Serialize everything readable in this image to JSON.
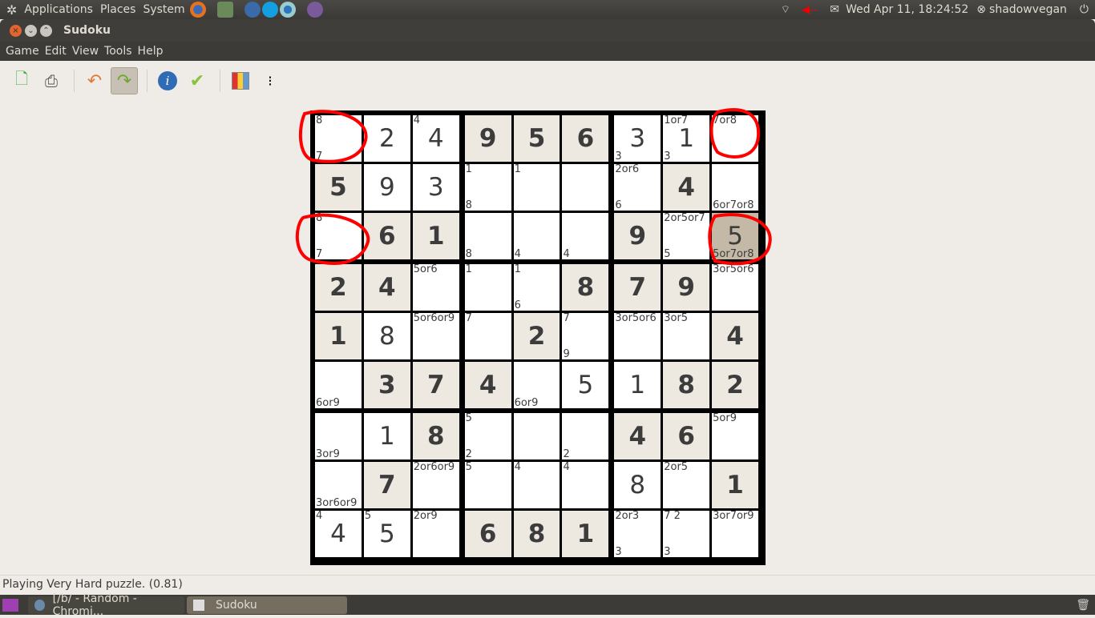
{
  "panel": {
    "menus": [
      "Applications",
      "Places",
      "System"
    ],
    "clock": "Wed Apr 11, 18:24:52",
    "user": "shadowvegan"
  },
  "window": {
    "title": "Sudoku",
    "menu": [
      "Game",
      "Edit",
      "View",
      "Tools",
      "Help"
    ]
  },
  "toolbar": {
    "icons": [
      "new-game-icon",
      "print-icon",
      "undo-icon",
      "redo-icon",
      "info-icon",
      "check-icon",
      "highlight-icon",
      "footprints-icon"
    ],
    "active": "redo-icon"
  },
  "colors": {
    "given_bg": "#ede9e1",
    "selected_bg": "#c4b9a7",
    "annotation": "#ff0000"
  },
  "grid": [
    [
      {
        "t": "8",
        "b": "7"
      },
      {
        "v": "2"
      },
      {
        "t": "4",
        "v": "4"
      },
      {
        "v": "9",
        "g": 1
      },
      {
        "v": "5",
        "g": 1
      },
      {
        "v": "6",
        "g": 1
      },
      {
        "v": "3",
        "b": "3"
      },
      {
        "t": "1or7",
        "v": "1",
        "b": "3"
      },
      {
        "t": "7or8"
      }
    ],
    [
      {
        "v": "5",
        "g": 1
      },
      {
        "v": "9"
      },
      {
        "v": "3"
      },
      {
        "t": "1",
        "b": "8"
      },
      {
        "t": "1"
      },
      {},
      {
        "t": "2or6",
        "b": "6"
      },
      {
        "v": "4",
        "g": 1
      },
      {
        "b": "6or7or8"
      }
    ],
    [
      {
        "t": "8",
        "b": "7"
      },
      {
        "v": "6",
        "g": 1
      },
      {
        "v": "1",
        "g": 1
      },
      {
        "b": "8"
      },
      {
        "b": "4"
      },
      {
        "b": "4"
      },
      {
        "v": "9",
        "g": 1
      },
      {
        "t": "2or5or7",
        "b": "5"
      },
      {
        "v": "5",
        "b": "5or7or8",
        "sel": 1
      }
    ],
    [
      {
        "v": "2",
        "g": 1
      },
      {
        "v": "4",
        "g": 1
      },
      {
        "t": "5or6"
      },
      {
        "t": "1"
      },
      {
        "t": "1",
        "b": "6"
      },
      {
        "v": "8",
        "g": 1
      },
      {
        "v": "7",
        "g": 1
      },
      {
        "v": "9",
        "g": 1
      },
      {
        "t": "3or5or6"
      }
    ],
    [
      {
        "v": "1",
        "g": 1
      },
      {
        "v": "8"
      },
      {
        "t": "5or6or9"
      },
      {
        "t": "7"
      },
      {
        "v": "2",
        "g": 1
      },
      {
        "t": "7",
        "b": "9"
      },
      {
        "t": "3or5or6"
      },
      {
        "t": "3or5"
      },
      {
        "v": "4",
        "g": 1
      }
    ],
    [
      {
        "b": "6or9"
      },
      {
        "v": "3",
        "g": 1
      },
      {
        "v": "7",
        "g": 1
      },
      {
        "v": "4",
        "g": 1
      },
      {
        "b": "6or9"
      },
      {
        "v": "5"
      },
      {
        "v": "1"
      },
      {
        "v": "8",
        "g": 1
      },
      {
        "v": "2",
        "g": 1
      }
    ],
    [
      {
        "b": "3or9"
      },
      {
        "v": "1"
      },
      {
        "v": "8",
        "g": 1
      },
      {
        "t": "5",
        "b": "2"
      },
      {},
      {
        "b": "2"
      },
      {
        "v": "4",
        "g": 1
      },
      {
        "v": "6",
        "g": 1
      },
      {
        "t": "5or9"
      }
    ],
    [
      {
        "b": "3or6or9"
      },
      {
        "v": "7",
        "g": 1
      },
      {
        "t": "2or6or9"
      },
      {
        "t": "5"
      },
      {
        "t": "4"
      },
      {
        "t": "4"
      },
      {
        "v": "8"
      },
      {
        "t": "2or5"
      },
      {
        "v": "1",
        "g": 1
      }
    ],
    [
      {
        "t": "4",
        "v": "4"
      },
      {
        "t": "5",
        "v": "5"
      },
      {
        "t": "2or9"
      },
      {
        "v": "6",
        "g": 1
      },
      {
        "v": "8",
        "g": 1
      },
      {
        "v": "1",
        "g": 1
      },
      {
        "t": "2or3",
        "b": "3"
      },
      {
        "t": "7 2",
        "b": "3"
      },
      {
        "t": "3or7or9"
      }
    ]
  ],
  "status": "Playing Very Hard puzzle. (0.81)",
  "taskbar": {
    "tasks": [
      "[/b/ - Random - Chromi...",
      "Sudoku"
    ]
  }
}
